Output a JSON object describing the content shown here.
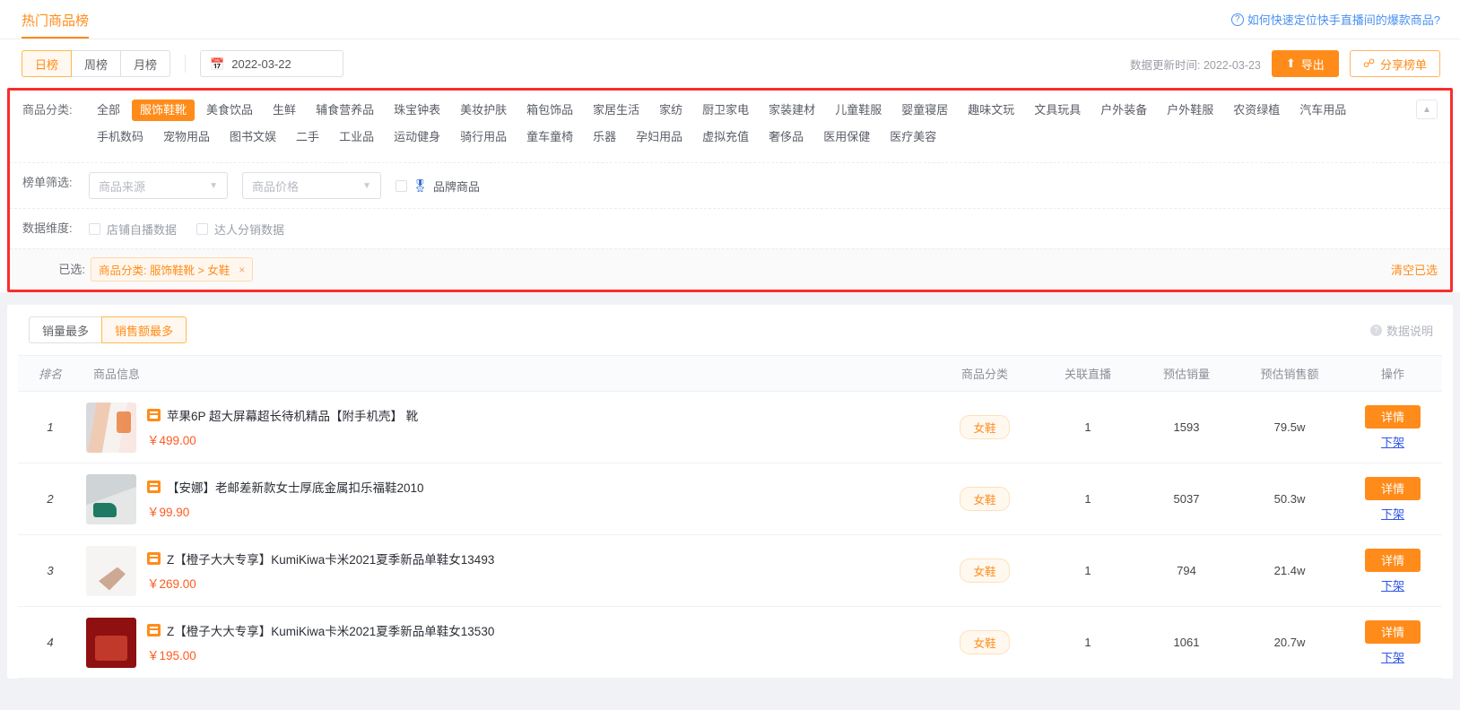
{
  "header": {
    "tab_title": "热门商品榜",
    "help_link": "如何快速定位快手直播间的爆款商品?",
    "help_icon": "question-circle-icon"
  },
  "toolbar": {
    "period_tabs": [
      {
        "label": "日榜",
        "active": true
      },
      {
        "label": "周榜",
        "active": false
      },
      {
        "label": "月榜",
        "active": false
      }
    ],
    "date_value": "2022-03-22",
    "calendar_icon": "calendar-icon",
    "update_time": "数据更新时间: 2022-03-23",
    "export_label": "导出",
    "export_icon": "upload-icon",
    "share_label": "分享榜单",
    "share_icon": "share-icon"
  },
  "filters": {
    "category": {
      "label": "商品分类:",
      "collapse_icon": "chevron-up-icon",
      "items": [
        {
          "label": "全部",
          "active": false
        },
        {
          "label": "服饰鞋靴",
          "active": true
        },
        {
          "label": "美食饮品",
          "active": false
        },
        {
          "label": "生鲜",
          "active": false
        },
        {
          "label": "辅食营养品",
          "active": false
        },
        {
          "label": "珠宝钟表",
          "active": false
        },
        {
          "label": "美妆护肤",
          "active": false
        },
        {
          "label": "箱包饰品",
          "active": false
        },
        {
          "label": "家居生活",
          "active": false
        },
        {
          "label": "家纺",
          "active": false
        },
        {
          "label": "厨卫家电",
          "active": false
        },
        {
          "label": "家装建材",
          "active": false
        },
        {
          "label": "儿童鞋服",
          "active": false
        },
        {
          "label": "婴童寝居",
          "active": false
        },
        {
          "label": "趣味文玩",
          "active": false
        },
        {
          "label": "文具玩具",
          "active": false
        },
        {
          "label": "户外装备",
          "active": false
        },
        {
          "label": "户外鞋服",
          "active": false
        },
        {
          "label": "农资绿植",
          "active": false
        },
        {
          "label": "汽车用品",
          "active": false
        },
        {
          "label": "手机数码",
          "active": false
        },
        {
          "label": "宠物用品",
          "active": false
        },
        {
          "label": "图书文娱",
          "active": false
        },
        {
          "label": "二手",
          "active": false
        },
        {
          "label": "工业品",
          "active": false
        },
        {
          "label": "运动健身",
          "active": false
        },
        {
          "label": "骑行用品",
          "active": false
        },
        {
          "label": "童车童椅",
          "active": false
        },
        {
          "label": "乐器",
          "active": false
        },
        {
          "label": "孕妇用品",
          "active": false
        },
        {
          "label": "虚拟充值",
          "active": false
        },
        {
          "label": "奢侈品",
          "active": false
        },
        {
          "label": "医用保健",
          "active": false
        },
        {
          "label": "医疗美容",
          "active": false
        }
      ]
    },
    "list_filter": {
      "label": "榜单筛选:",
      "source_placeholder": "商品来源",
      "price_placeholder": "商品价格",
      "brand_checkbox_label": "品牌商品",
      "brand_icon": "medal-icon",
      "brand_checked": false
    },
    "dimension": {
      "label": "数据维度:",
      "options": [
        {
          "label": "店铺自播数据",
          "checked": false
        },
        {
          "label": "达人分销数据",
          "checked": false
        }
      ]
    },
    "selected": {
      "label": "已选:",
      "chip_prefix": "商品分类:",
      "chip_value": "服饰鞋靴 > 女鞋",
      "chip_close": "×",
      "clear_label": "清空已选"
    }
  },
  "ranking": {
    "tabs": [
      {
        "label": "销量最多",
        "active": false
      },
      {
        "label": "销售额最多",
        "active": true
      }
    ],
    "data_note": "数据说明",
    "data_note_icon": "question-circle-grey-icon",
    "columns": [
      "排名",
      "商品信息",
      "商品分类",
      "关联直播",
      "预估销量",
      "预估销售额",
      "操作"
    ],
    "detail_label": "详情",
    "off_shelf_label": "下架",
    "rows": [
      {
        "rank": "1",
        "title": "苹果6P 超大屏幕超长待机精品【附手机壳】 靴",
        "price": "￥499.00",
        "category": "女鞋",
        "lives": "1",
        "sales": "1593",
        "amount": "79.5w",
        "thumb": "t1"
      },
      {
        "rank": "2",
        "title": "【安娜】老邮差新款女士厚底金属扣乐福鞋2010",
        "price": "￥99.90",
        "category": "女鞋",
        "lives": "1",
        "sales": "5037",
        "amount": "50.3w",
        "thumb": "t2"
      },
      {
        "rank": "3",
        "title": "Z【橙子大大专享】KumiKiwa卡米2021夏季新品单鞋女13493",
        "price": "￥269.00",
        "category": "女鞋",
        "lives": "1",
        "sales": "794",
        "amount": "21.4w",
        "thumb": "t3"
      },
      {
        "rank": "4",
        "title": "Z【橙子大大专享】KumiKiwa卡米2021夏季新品单鞋女13530",
        "price": "￥195.00",
        "category": "女鞋",
        "lives": "1",
        "sales": "1061",
        "amount": "20.7w",
        "thumb": "t4"
      }
    ]
  },
  "colors": {
    "accent": "#ff8c1a",
    "highlight_border": "#fb2c2c",
    "link": "#2f54eb",
    "help": "#4a90f0"
  }
}
